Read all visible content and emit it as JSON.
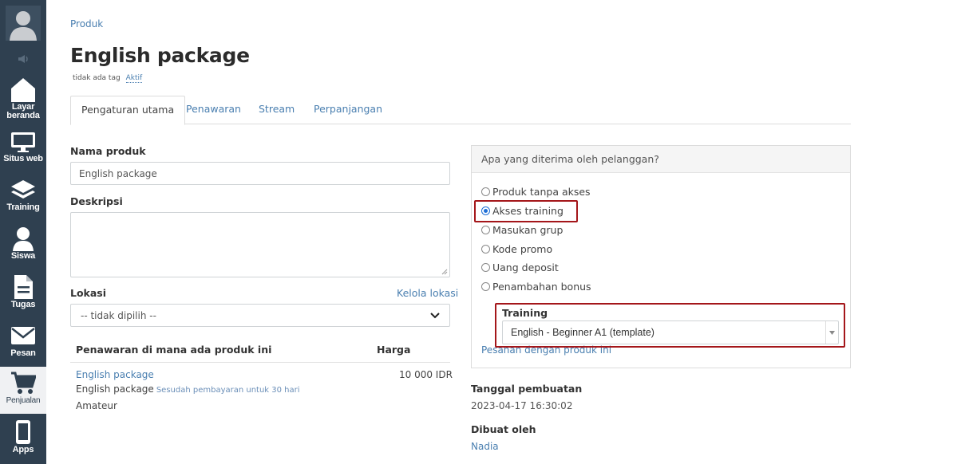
{
  "sidebar": {
    "items": [
      {
        "label_1": "Layar",
        "label_2": "beranda",
        "icon": "home-icon"
      },
      {
        "label": "Situs web",
        "icon": "monitor-icon"
      },
      {
        "label": "Training",
        "icon": "layers-icon"
      },
      {
        "label": "Siswa",
        "icon": "user-icon"
      },
      {
        "label": "Tugas",
        "icon": "document-icon"
      },
      {
        "label": "Pesan",
        "icon": "envelope-icon"
      },
      {
        "label": "Penjualan",
        "icon": "cart-icon"
      },
      {
        "label": "Apps",
        "icon": "phone-icon"
      }
    ],
    "active": "Penjualan",
    "bg_color": "#2f4050"
  },
  "breadcrumb": "Produk",
  "title": "English package",
  "tagline": {
    "no_tag": "tidak ada tag",
    "status": "Aktif"
  },
  "tabs": [
    {
      "label": "Pengaturan utama",
      "active": true
    },
    {
      "label": "Penawaran",
      "active": false
    },
    {
      "label": "Stream",
      "active": false
    },
    {
      "label": "Perpanjangan",
      "active": false
    }
  ],
  "form": {
    "name_label": "Nama produk",
    "name_value": "English package",
    "desc_label": "Deskripsi",
    "desc_value": "",
    "location_label": "Lokasi",
    "location_link": "Kelola lokasi",
    "location_value": "-- tidak dipilih --"
  },
  "offers_table": {
    "headers": [
      "Penawaran di mana ada produk ini",
      "Harga"
    ],
    "rows": [
      {
        "offer": "English package",
        "product": "English package",
        "note": "Sesudah pembayaran untuk 30 hari",
        "group": "Amateur",
        "price": "10 000 IDR"
      }
    ]
  },
  "panel": {
    "title": "Apa yang diterima oleh pelanggan?",
    "options": [
      {
        "label": "Produk tanpa akses",
        "checked": false
      },
      {
        "label": "Akses training",
        "checked": true
      },
      {
        "label": "Masukan grup",
        "checked": false
      },
      {
        "label": "Kode promo",
        "checked": false
      },
      {
        "label": "Uang deposit",
        "checked": false
      },
      {
        "label": "Penambahan bonus",
        "checked": false
      }
    ],
    "training_label": "Training",
    "training_value": "English - Beginner A1 (template)",
    "orders_link": "Pesanan dengan produk ini",
    "highlight_color": "#a4161a"
  },
  "meta": {
    "created_label": "Tanggal pembuatan",
    "created_value": "2023-04-17 16:30:02",
    "author_label": "Dibuat oleh",
    "author_value": "Nadia"
  },
  "colors": {
    "link": "#4a7fb0",
    "radio_checked": "#1f6fd6"
  }
}
